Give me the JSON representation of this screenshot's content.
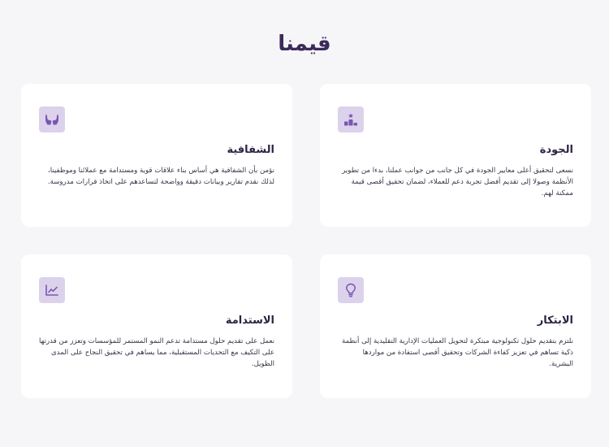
{
  "page": {
    "title": "قيمنا"
  },
  "colors": {
    "background": "#f6f6f8",
    "card": "#ffffff",
    "icon_tile": "#dcd2ec",
    "icon": "#7a56b3",
    "title": "#3b2a5c"
  },
  "cards": [
    {
      "icon": "podium-icon",
      "title": "الجودة",
      "text": "نسعى لتحقيق أعلى معايير الجودة في كل جانب من جوانب عملنا، بدءا من تطوير الأنظمة وصولا إلى تقديم أفضل تجربة دعم للعملاء، لضمان تحقيق أقصى قيمة ممكنة لهم."
    },
    {
      "icon": "hands-icon",
      "title": "الشفافية",
      "text": "نؤمن بأن الشفافية هي أساس بناء علاقات قوية ومستدامة مع عملائنا وموظفينا، لذلك نقدم تقارير وبيانات دقيقة وواضحة لتساعدهم على اتخاذ قرارات مدروسة."
    },
    {
      "icon": "lightbulb-icon",
      "title": "الابتكار",
      "text": "نلتزم بتقديم حلول تكنولوجية مبتكرة لتحويل العمليات الإدارية التقليدية إلى أنظمة ذكية تساهم في تعزيز كفاءة الشركات وتحقيق أقصى استفادة من مواردها البشرية."
    },
    {
      "icon": "chart-line-icon",
      "title": "الاستدامة",
      "text": "نعمل على تقديم حلول مستدامة تدعم النمو المستمر للمؤسسات وتعزز من قدرتها على التكيف مع التحديات المستقبلية، مما يساهم في تحقيق النجاح على المدى الطويل."
    }
  ]
}
